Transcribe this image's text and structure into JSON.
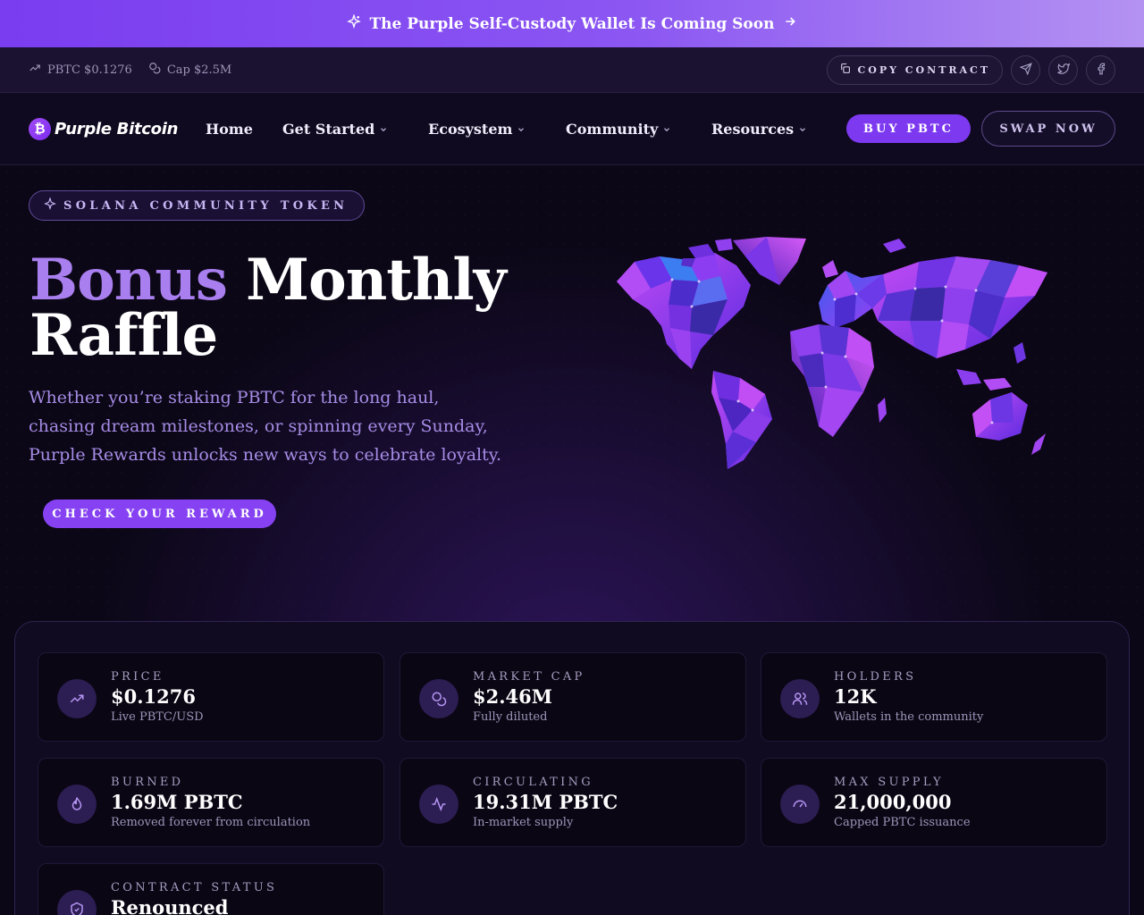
{
  "announcement": {
    "text": "The Purple Self-Custody Wallet Is Coming Soon",
    "icon": "sparkle-icon",
    "arrow_icon": "arrow-right-icon"
  },
  "topbar": {
    "price_text": "PBTC $0.1276",
    "cap_text": "Cap $2.5M",
    "copy_label": "COPY CONTRACT",
    "socials": [
      "telegram-icon",
      "twitter-icon",
      "facebook-icon"
    ]
  },
  "nav": {
    "logo_symbol": "₿",
    "logo_text": "Purple Bitcoin",
    "links": [
      {
        "label": "Home",
        "dropdown": false
      },
      {
        "label": "Get Started",
        "dropdown": true
      },
      {
        "label": "Ecosystem",
        "dropdown": true
      },
      {
        "label": "Community",
        "dropdown": true
      },
      {
        "label": "Resources",
        "dropdown": true
      }
    ],
    "buy_label": "BUY PBTC",
    "swap_label": "SWAP NOW"
  },
  "hero": {
    "pill": "SOLANA COMMUNITY TOKEN",
    "headline_accent": "Bonus",
    "headline_rest": "Monthly",
    "headline_line2": "Raffle",
    "subtext": "Whether you’re staking PBTC for the long haul, chasing dream milestones, or spinning every Sunday, Purple Rewards unlocks new ways to celebrate loyalty.",
    "cta": "CHECK YOUR REWARD",
    "image": "low-poly-world-map"
  },
  "stats": [
    {
      "label": "PRICE",
      "value": "$0.1276",
      "sub": "Live PBTC/USD",
      "icon": "trending-up-icon"
    },
    {
      "label": "MARKET CAP",
      "value": "$2.46M",
      "sub": "Fully diluted",
      "icon": "coins-icon"
    },
    {
      "label": "HOLDERS",
      "value": "12K",
      "sub": "Wallets in the community",
      "icon": "users-icon"
    },
    {
      "label": "BURNED",
      "value": "1.69M PBTC",
      "sub": "Removed forever from circulation",
      "icon": "flame-icon"
    },
    {
      "label": "CIRCULATING",
      "value": "19.31M PBTC",
      "sub": "In-market supply",
      "icon": "activity-icon"
    },
    {
      "label": "MAX SUPPLY",
      "value": "21,000,000",
      "sub": "Capped PBTC issuance",
      "icon": "gauge-icon"
    },
    {
      "label": "CONTRACT STATUS",
      "value": "Renounced",
      "sub": "",
      "icon": "shield-check-icon"
    }
  ],
  "colors": {
    "accent": "#7d39f0",
    "accent_light": "#a97ff0",
    "background": "#0b0716",
    "banner_start": "#7a3df0",
    "banner_end": "#b492f2"
  }
}
